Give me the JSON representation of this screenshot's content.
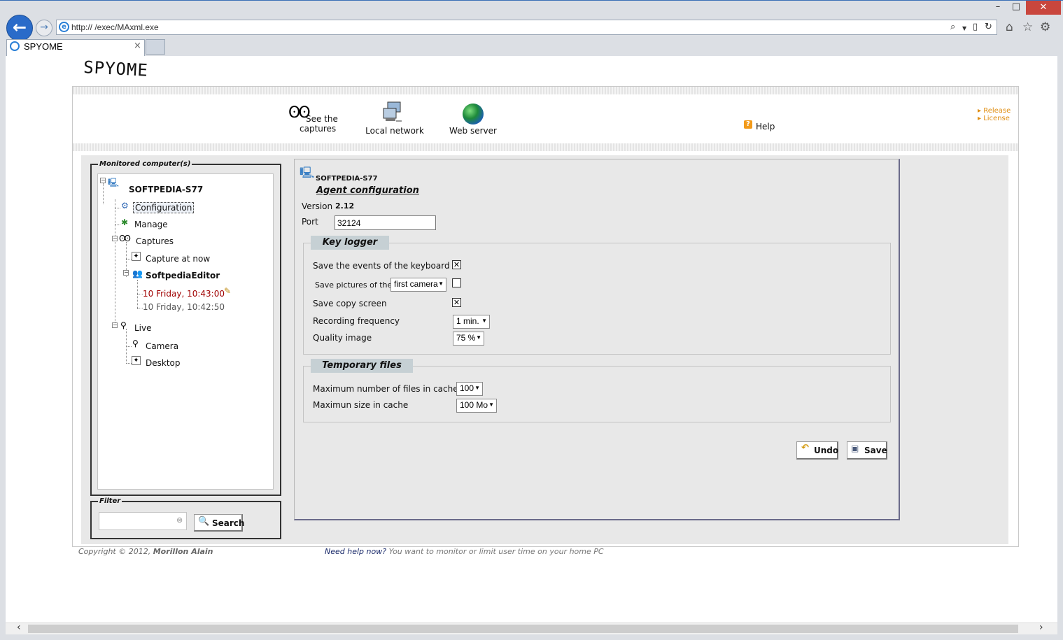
{
  "browser": {
    "address": "http://          /exec/MAxml.exe",
    "tab_title": "SPYOME",
    "tab_close": "×",
    "minimize": "–",
    "maximize": "□",
    "close": "✕"
  },
  "logo": "SPYOME",
  "nav": {
    "captures": "See the captures",
    "local_network": "Local network",
    "web_server": "Web server",
    "help": "Help",
    "release": "Release",
    "license": "License"
  },
  "sidebar": {
    "legend": "Monitored computer(s)",
    "computer": "SOFTPEDIA-S77",
    "configuration": "Configuration",
    "manage": "Manage",
    "captures": "Captures",
    "capture_now": "Capture at now",
    "user": "SoftpediaEditor",
    "entry_1": "10 Friday, 10:43:00",
    "entry_2": "10 Friday, 10:42:50",
    "live": "Live",
    "camera": "Camera",
    "desktop": "Desktop"
  },
  "filter": {
    "legend": "Filter",
    "value": "",
    "search_label": "Search"
  },
  "agent": {
    "computer": "SOFTPEDIA-S77",
    "title": "Agent configuration",
    "version_label": "Version",
    "version_value": "2.12",
    "port_label": "Port",
    "port_value": "32124"
  },
  "keylogger": {
    "title": "Key logger",
    "keyboard_label": "Save the events of the keyboard",
    "keyboard_checked": "✕",
    "pictures_label": "Save pictures of the",
    "camera_select": "first camera",
    "pictures_checked": "",
    "copy_screen_label": "Save copy screen",
    "copy_screen_checked": "✕",
    "frequency_label": "Recording frequency",
    "frequency_value": "1 min.",
    "quality_label": "Quality image",
    "quality_value": "75 %"
  },
  "temp_files": {
    "title": "Temporary files",
    "max_files_label": "Maximum number of files in cache",
    "max_files_value": "100",
    "max_size_label": "Maximun size in cache",
    "max_size_value": "100 Mo"
  },
  "actions": {
    "undo": "Undo",
    "save": "Save"
  },
  "footer": {
    "copyright": "Copyright © 2012,",
    "author": "Morillon Alain",
    "help_link": "Need help now?",
    "tagline": "You want to monitor or limit user time on your home PC"
  }
}
